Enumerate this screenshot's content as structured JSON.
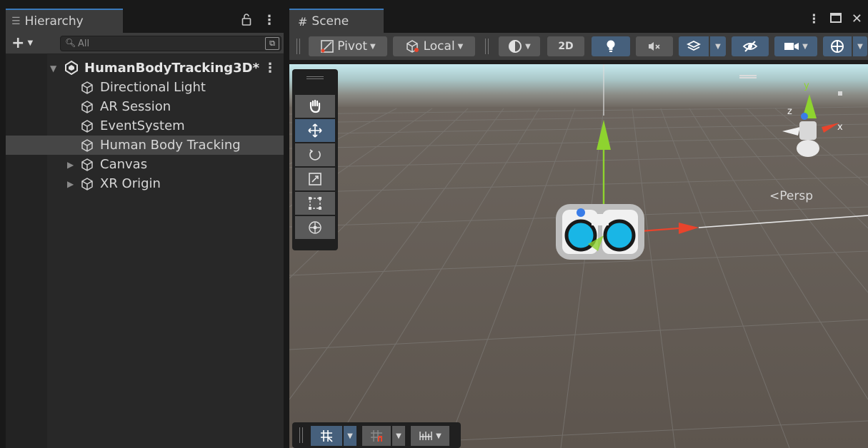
{
  "hierarchy": {
    "tab_title": "Hierarchy",
    "search_placeholder": "All",
    "scene_name": "HumanBodyTracking3D*",
    "items": [
      {
        "label": "Directional Light"
      },
      {
        "label": "AR Session"
      },
      {
        "label": "EventSystem"
      },
      {
        "label": "Human Body Tracking"
      },
      {
        "label": "Canvas"
      },
      {
        "label": "XR Origin"
      }
    ],
    "selected_item": "Human Body Tracking",
    "collapsed_items": [
      "Canvas",
      "XR Origin"
    ]
  },
  "scene": {
    "tab_title": "Scene",
    "pivot_label": "Pivot",
    "local_label": "Local",
    "mode_2d_label": "2D",
    "projection_label": "Persp",
    "gizmo_axes": {
      "x": "x",
      "y": "y",
      "z": "z"
    },
    "active_tool": "move"
  },
  "colors": {
    "accent": "#3a79bb",
    "button_on": "#46607c",
    "x_axis": "#e8442c",
    "y_axis": "#8ed32f",
    "z_axis": "#3a7de8",
    "ground": "#5d554e",
    "sky": "#c5e9ee",
    "binocular_lens": "#19b6e6"
  },
  "icons": {
    "hierarchy_tab": "list-icon",
    "scene_tab": "grid-icon",
    "lock": "lock-icon",
    "menu": "kebab-menu-icon",
    "add": "plus-icon",
    "search": "search-icon",
    "object": "cube-icon",
    "scene": "unity-scene-icon"
  }
}
